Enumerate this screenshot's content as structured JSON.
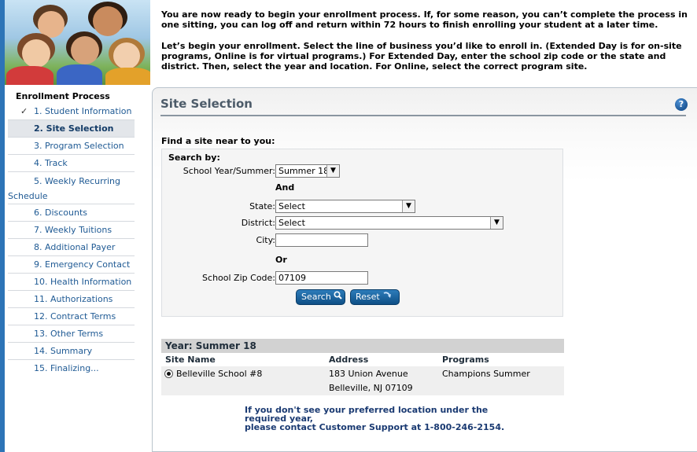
{
  "intro": {
    "paragraph1": "You are now ready to begin your enrollment process. If, for some reason, you can’t complete the process in one sitting, you can log off and return within 72 hours to finish enrolling your student at a later time.",
    "paragraph2": "Let’s begin your enrollment. Select the line of business you’d like to enroll in. (Extended Day is for on-site programs, Online is for virtual programs.) For Extended Day, enter the school zip code or the state and district. Then, select the year and location. For Online, select the correct program site."
  },
  "sidebar": {
    "title": "Enrollment Process",
    "items": [
      {
        "label": "1. Student Information",
        "completed": true
      },
      {
        "label": "2. Site Selection",
        "active": true
      },
      {
        "label": "3. Program Selection"
      },
      {
        "label": "4. Track"
      },
      {
        "label_line1": "5. Weekly Recurring",
        "label_line2": "Schedule"
      },
      {
        "label": "6. Discounts"
      },
      {
        "label": "7. Weekly Tuitions"
      },
      {
        "label": "8. Additional Payer"
      },
      {
        "label": "9. Emergency Contact"
      },
      {
        "label": "10. Health Information"
      },
      {
        "label": "11. Authorizations"
      },
      {
        "label": "12. Contract Terms"
      },
      {
        "label": "13. Other Terms"
      },
      {
        "label": "14. Summary"
      },
      {
        "label": "15. Finalizing..."
      }
    ],
    "check_glyph": "✓"
  },
  "panel": {
    "title": "Site Selection",
    "help_glyph": "?",
    "find_label": "Find a site near to you:",
    "search_by": "Search by:",
    "year_label": "School Year/Summer:",
    "year_value": "Summer 18",
    "and_label": "And",
    "state_label": "State:",
    "state_value": "Select",
    "district_label": "District:",
    "district_value": "Select",
    "city_label": "City:",
    "city_value": "",
    "or_label": "Or",
    "zip_label": "School Zip Code:",
    "zip_value": "07109",
    "search_button": "Search",
    "reset_button": "Reset"
  },
  "results": {
    "heading": "Year: Summer 18",
    "columns": [
      "Site Name",
      "Address",
      "Programs"
    ],
    "rows": [
      {
        "site": "Belleville School #8",
        "address_line1": "183 Union Avenue",
        "address_line2": "Belleville, NJ 07109",
        "program": "Champions Summer"
      }
    ]
  },
  "support": {
    "line1": "If you don't see your preferred location under the",
    "line2": "required year,",
    "line3": "please contact Customer Support at 1-800-246-2154."
  },
  "colors": {
    "accent_blue": "#2d74b7",
    "nav_link": "#1f5a94",
    "button": "#0e4f86"
  }
}
